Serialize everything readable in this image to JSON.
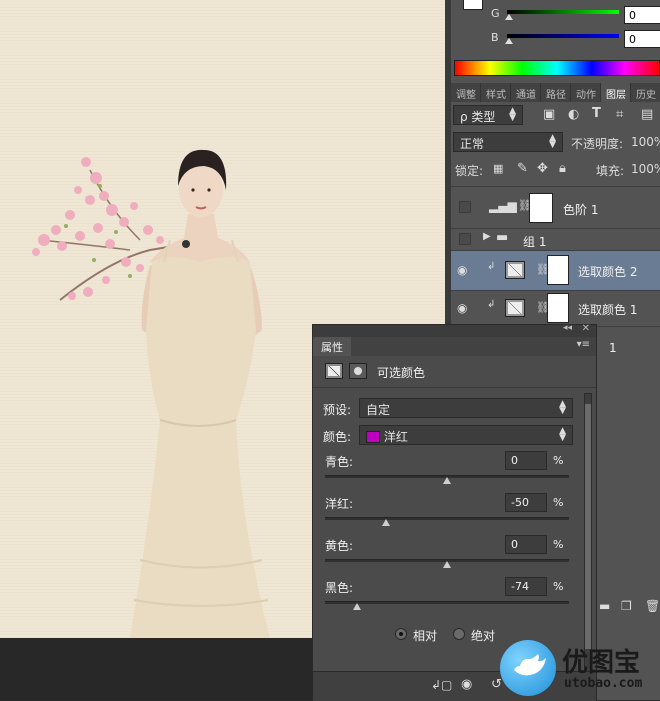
{
  "color_panel": {
    "g_label": "G",
    "b_label": "B",
    "g_value": "0",
    "b_value": "0"
  },
  "layers_panel": {
    "tabs": [
      "调整",
      "样式",
      "通道",
      "路径",
      "动作",
      "图层",
      "历史"
    ],
    "active_tab": "图层",
    "filter_kind": "ρ 类型",
    "blend_mode": "正常",
    "opacity_label": "不透明度:",
    "opacity_value": "100%",
    "lock_label": "锁定:",
    "fill_label": "填充:",
    "fill_value": "100%",
    "layers": [
      {
        "name": "色阶 1",
        "visible": false,
        "selected": false
      },
      {
        "name": "组 1",
        "visible": false,
        "selected": false
      },
      {
        "name": "选取颜色 2",
        "visible": true,
        "selected": true
      },
      {
        "name": "选取颜色 1",
        "visible": true,
        "selected": false
      },
      {
        "name": "1",
        "visible": true,
        "selected": false
      }
    ]
  },
  "properties_panel": {
    "tab_label": "属性",
    "title": "可选颜色",
    "preset_label": "预设:",
    "preset_value": "自定",
    "color_label": "颜色:",
    "color_value": "洋红",
    "color_swatch": "#c000c0",
    "sliders": [
      {
        "label": "青色:",
        "value": "0",
        "unit": "%",
        "level": 0
      },
      {
        "label": "洋红:",
        "value": "-50",
        "unit": "%",
        "level": -50
      },
      {
        "label": "黄色:",
        "value": "0",
        "unit": "%",
        "level": 0
      },
      {
        "label": "黑色:",
        "value": "-74",
        "unit": "%",
        "level": -74
      }
    ],
    "method_relative": "相对",
    "method_absolute": "绝对",
    "method_selected": "相对"
  },
  "watermark": {
    "brand": "优图宝",
    "url": "utobao.com"
  }
}
